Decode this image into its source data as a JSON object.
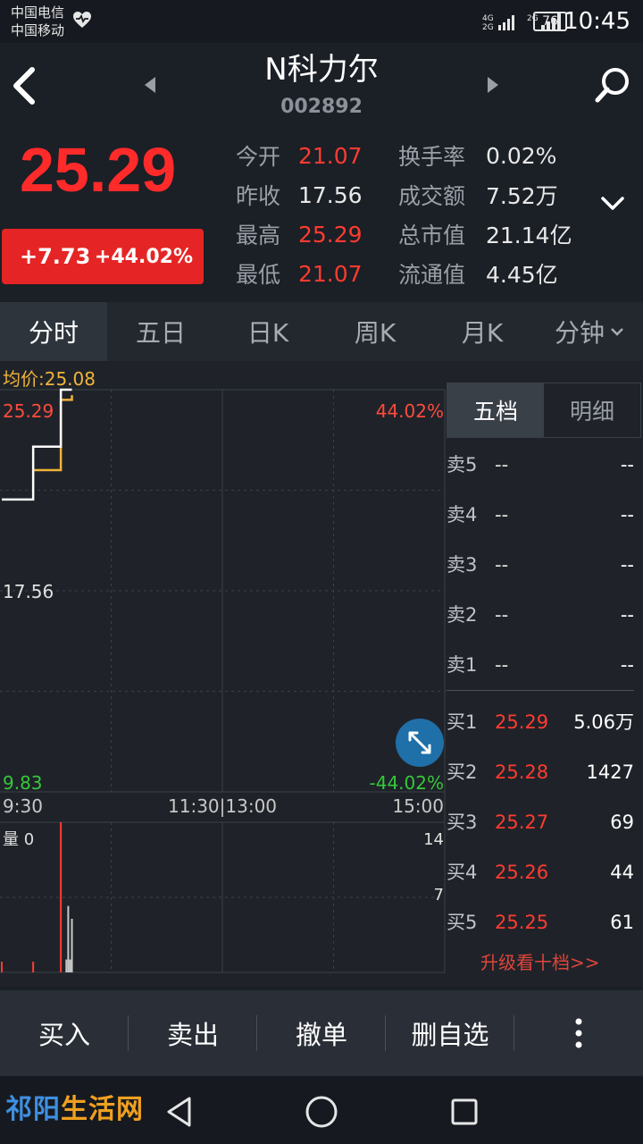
{
  "status_bar": {
    "carrier_1": "中国电信",
    "carrier_2": "中国移动",
    "battery": "76",
    "time": "10:45"
  },
  "header": {
    "stock_name": "N科力尔",
    "stock_code": "002892"
  },
  "quote": {
    "price": "25.29",
    "change_abs": "+7.73",
    "change_pct": "+44.02%",
    "fields_left": [
      {
        "label": "今开",
        "value": "21.07",
        "color": "red"
      },
      {
        "label": "昨收",
        "value": "17.56",
        "color": "white"
      },
      {
        "label": "最高",
        "value": "25.29",
        "color": "red"
      },
      {
        "label": "最低",
        "value": "21.07",
        "color": "red"
      }
    ],
    "fields_right": [
      {
        "label": "换手率",
        "value": "0.02%"
      },
      {
        "label": "成交额",
        "value": "7.52万"
      },
      {
        "label": "总市值",
        "value": "21.14亿"
      },
      {
        "label": "流通值",
        "value": "4.45亿"
      }
    ],
    "colors": {
      "up": "#ff3b30",
      "down": "#35c83a",
      "avg_line": "#f0b43a",
      "price_line": "#ffffff"
    }
  },
  "tabs": [
    {
      "label": "分时",
      "active": true
    },
    {
      "label": "五日",
      "active": false
    },
    {
      "label": "日K",
      "active": false
    },
    {
      "label": "周K",
      "active": false
    },
    {
      "label": "月K",
      "active": false
    },
    {
      "label": "分钟",
      "active": false,
      "dropdown": true
    }
  ],
  "chart": {
    "avg_price_label": "均价:25.08",
    "high_price": "25.29",
    "high_pct": "44.02%",
    "prev_close": "17.56",
    "low_price": "9.83",
    "low_pct": "-44.02%",
    "time_open": "9:30",
    "time_mid": "11:30|13:00",
    "time_close": "15:00",
    "volume_label": "量 0",
    "volume_max": "14",
    "volume_mid": "7"
  },
  "chart_data": {
    "type": "line",
    "title": "",
    "xlabel": "",
    "ylabel": "",
    "x_range": [
      "9:30",
      "15:00"
    ],
    "ylim": [
      9.83,
      25.29
    ],
    "reference_line": 17.56,
    "series": [
      {
        "x": [
          0,
          16,
          17,
          31,
          32,
          38
        ],
        "values": [
          21.07,
          21.07,
          23.1,
          23.1,
          25.29,
          25.29
        ]
      },
      {
        "x": [
          0,
          16,
          17,
          31,
          32,
          38
        ],
        "values": [
          null,
          null,
          22.2,
          22.2,
          24.9,
          25.08
        ]
      }
    ],
    "volume": {
      "ylim": [
        0,
        14
      ],
      "bars": [
        {
          "x": 0,
          "value": 1
        },
        {
          "x": 17,
          "value": 1
        },
        {
          "x": 32,
          "value": 14
        },
        {
          "x": 35,
          "value": 1.2
        },
        {
          "x": 36,
          "value": 6.2
        },
        {
          "x": 37,
          "value": 1.2
        },
        {
          "x": 38,
          "value": 5
        }
      ]
    }
  },
  "order_book": {
    "tabs": [
      {
        "label": "五档",
        "active": true
      },
      {
        "label": "明细",
        "active": false
      }
    ],
    "sell": [
      {
        "label": "卖5",
        "price": "--",
        "volume": "--"
      },
      {
        "label": "卖4",
        "price": "--",
        "volume": "--"
      },
      {
        "label": "卖3",
        "price": "--",
        "volume": "--"
      },
      {
        "label": "卖2",
        "price": "--",
        "volume": "--"
      },
      {
        "label": "卖1",
        "price": "--",
        "volume": "--"
      }
    ],
    "buy": [
      {
        "label": "买1",
        "price": "25.29",
        "volume": "5.06万"
      },
      {
        "label": "买2",
        "price": "25.28",
        "volume": "1427"
      },
      {
        "label": "买3",
        "price": "25.27",
        "volume": "69"
      },
      {
        "label": "买4",
        "price": "25.26",
        "volume": "44"
      },
      {
        "label": "买5",
        "price": "25.25",
        "volume": "61"
      }
    ],
    "upgrade_link": "升级看十档>>"
  },
  "toolbar": {
    "buy": "买入",
    "sell": "卖出",
    "cancel": "撤单",
    "remove_watch": "删自选",
    "more_icon": "more-vertical-icon"
  },
  "watermark": {
    "part_1": "祁阳",
    "part_2": "生活网"
  }
}
